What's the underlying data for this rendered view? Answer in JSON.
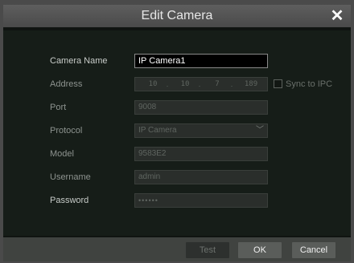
{
  "dialog": {
    "title": "Edit Camera"
  },
  "form": {
    "camera_name": {
      "label": "Camera Name",
      "value": "IP Camera1"
    },
    "address": {
      "label": "Address",
      "octets": [
        "10",
        "10",
        "7",
        "189"
      ],
      "dots": [
        ".",
        ".",
        "."
      ],
      "sync_label": "Sync to IPC",
      "sync_checked": false
    },
    "port": {
      "label": "Port",
      "value": "9008"
    },
    "protocol": {
      "label": "Protocol",
      "value": "IP Camera"
    },
    "model": {
      "label": "Model",
      "value": "9583E2"
    },
    "username": {
      "label": "Username",
      "value": "admin"
    },
    "password": {
      "label": "Password",
      "value": "••••••"
    }
  },
  "buttons": {
    "test": "Test",
    "ok": "OK",
    "cancel": "Cancel"
  },
  "icons": {
    "close": "close-icon",
    "dropdown": "chevron-down-icon"
  },
  "colors": {
    "dialog_bg": "#101411",
    "titlebar": "#4a4a4a",
    "footer": "#404340",
    "button": "#5a5d5a"
  }
}
